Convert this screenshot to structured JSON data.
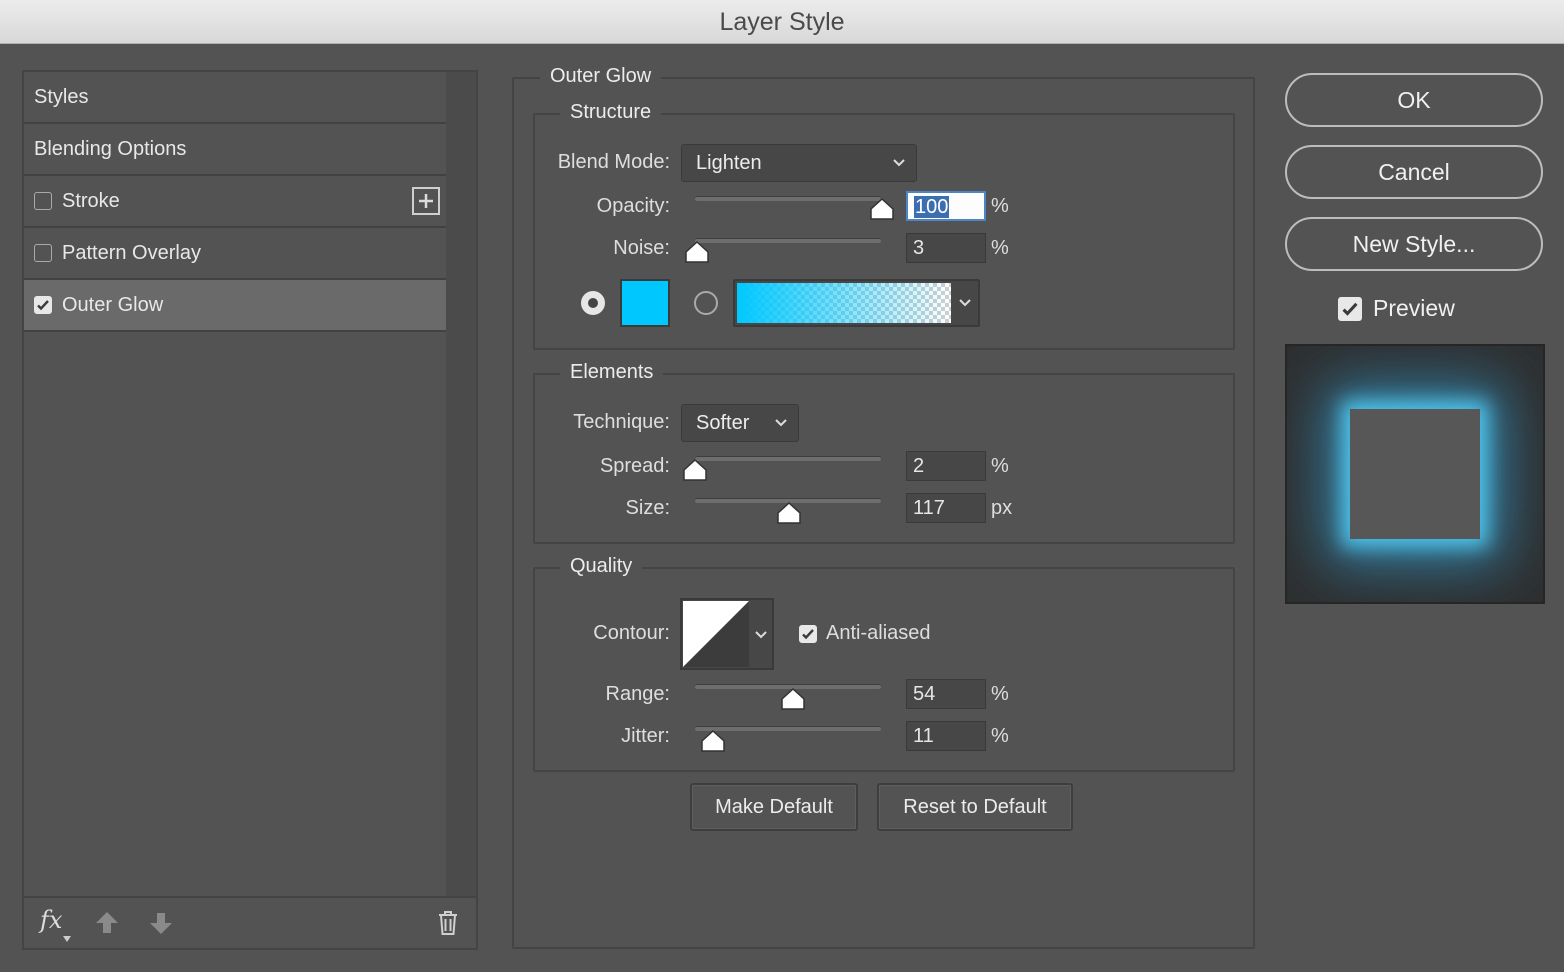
{
  "window": {
    "title": "Layer Style"
  },
  "left_panel": {
    "items": [
      {
        "label": "Styles",
        "checkbox": false,
        "checked": false,
        "selected": false
      },
      {
        "label": "Blending Options",
        "checkbox": false,
        "checked": false,
        "selected": false
      },
      {
        "label": "Stroke",
        "checkbox": true,
        "checked": false,
        "selected": false,
        "addable": true
      },
      {
        "label": "Pattern Overlay",
        "checkbox": true,
        "checked": false,
        "selected": false
      },
      {
        "label": "Outer Glow",
        "checkbox": true,
        "checked": true,
        "selected": true
      }
    ],
    "footer": {
      "fx_label": "fx",
      "icons": [
        "fx-menu-icon",
        "move-up-icon",
        "move-down-icon",
        "trash-icon"
      ]
    }
  },
  "outer_glow": {
    "section_title": "Outer Glow",
    "structure": {
      "title": "Structure",
      "blend_mode_label": "Blend Mode:",
      "blend_mode_value": "Lighten",
      "opacity_label": "Opacity:",
      "opacity_value": "100",
      "opacity_unit": "%",
      "opacity_level": 1.0,
      "noise_label": "Noise:",
      "noise_value": "3",
      "noise_unit": "%",
      "noise_level": 0.03,
      "fill_mode": "solid",
      "color": "#00c8ff",
      "gradient_from": "#00c8ff"
    },
    "elements": {
      "title": "Elements",
      "technique_label": "Technique:",
      "technique_value": "Softer",
      "spread_label": "Spread:",
      "spread_value": "2",
      "spread_unit": "%",
      "spread_level": 0.02,
      "size_label": "Size:",
      "size_value": "117",
      "size_unit": "px",
      "size_level": 0.47
    },
    "quality": {
      "title": "Quality",
      "contour_label": "Contour:",
      "anti_aliased_label": "Anti-aliased",
      "anti_aliased": true,
      "range_label": "Range:",
      "range_value": "54",
      "range_unit": "%",
      "range_level": 0.54,
      "jitter_label": "Jitter:",
      "jitter_value": "11",
      "jitter_unit": "%",
      "jitter_level": 0.11
    },
    "make_default_label": "Make Default",
    "reset_default_label": "Reset to Default"
  },
  "actions": {
    "ok_label": "OK",
    "cancel_label": "Cancel",
    "new_style_label": "New Style...",
    "preview_label": "Preview",
    "preview_checked": true,
    "glow_color": "#4fc3ef"
  }
}
